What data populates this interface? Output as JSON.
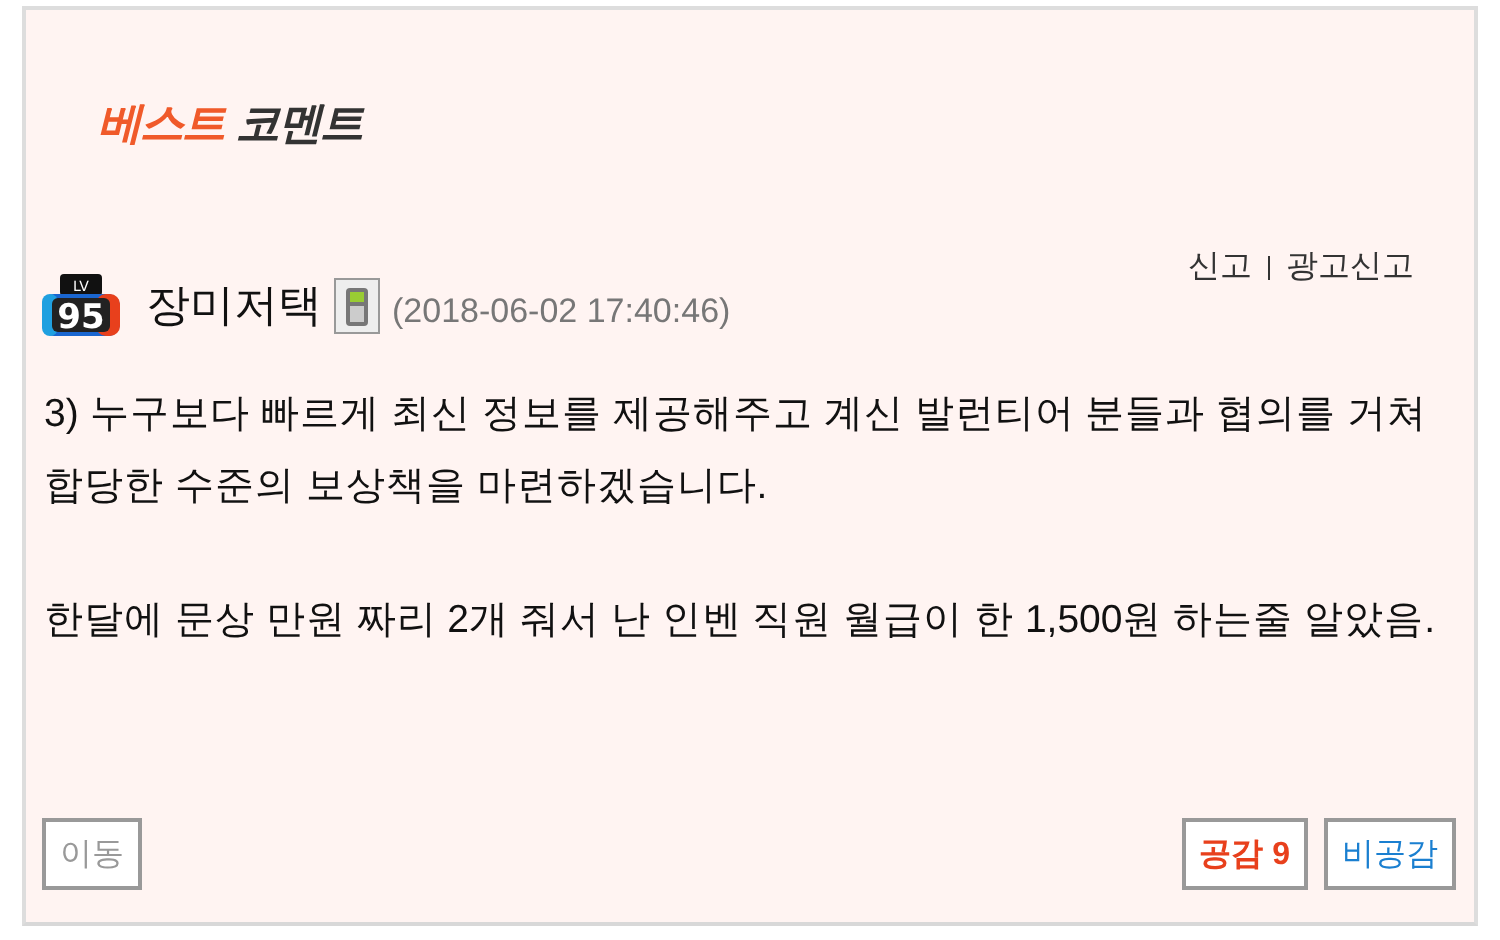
{
  "header": {
    "title_accent": "베스트",
    "title_rest": "코멘트"
  },
  "comment": {
    "badge_label": "LV",
    "badge_level": "95",
    "author": "장미저택",
    "date": "(2018-06-02 17:40:46)",
    "actions": [
      {
        "label": "신고"
      },
      {
        "label": "광고신고"
      }
    ],
    "paragraphs": [
      "3) 누구보다 빠르게 최신 정보를 제공해주고 계신 발런티어 분들과 협의를 거쳐 합당한 수준의 보상책을 마련하겠습니다.",
      "한달에 문상 만원 짜리 2개 줘서 난 인벤 직원 월급이 한 1,500원 하는줄 알았음."
    ],
    "buttons": [
      {
        "kind": "move",
        "label": "이동"
      },
      {
        "kind": "like",
        "label": "공감",
        "count": "9"
      },
      {
        "kind": "dislike",
        "label": "비공감"
      }
    ]
  }
}
